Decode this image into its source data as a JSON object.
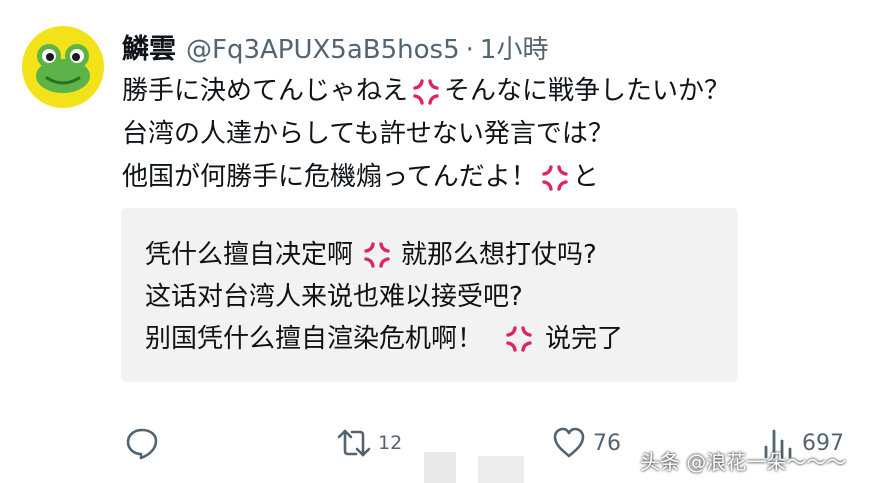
{
  "tweet": {
    "display_name": "鱗雲",
    "handle": "@Fq3APUX5aB5hos5",
    "separator": "·",
    "time": "1小時",
    "lines": [
      [
        "勝手に決めてんじゃねえ",
        "そんなに戦争したいか？"
      ],
      [
        "台湾の人達からしても許せない発言では？"
      ],
      [
        "他国が何勝手に危機煽ってんだよ！",
        "と"
      ]
    ]
  },
  "translation": {
    "lines": [
      [
        "凭什么擅自决定啊",
        "就那么想打仗吗?"
      ],
      [
        "这话对台湾人来说也难以接受吧?"
      ],
      [
        "别国凭什么擅自渲染危机啊！",
        "说完了"
      ]
    ]
  },
  "actions": {
    "reply_count": "",
    "retweet_count": "12",
    "like_count": "76",
    "view_count": "697"
  },
  "watermark": "头条 @浪花一朵～～～",
  "icons": {
    "reply": "speech-bubble-icon",
    "retweet": "retweet-arrows-icon",
    "like": "heart-icon",
    "views": "bar-chart-icon",
    "anger": "anger-symbol-icon"
  },
  "colors": {
    "avatar_bg": "#f3e21a",
    "frog_green": "#5bb34a",
    "anger_red": "#e0245e",
    "muted": "#536471",
    "box_bg": "#f2f2f2"
  }
}
